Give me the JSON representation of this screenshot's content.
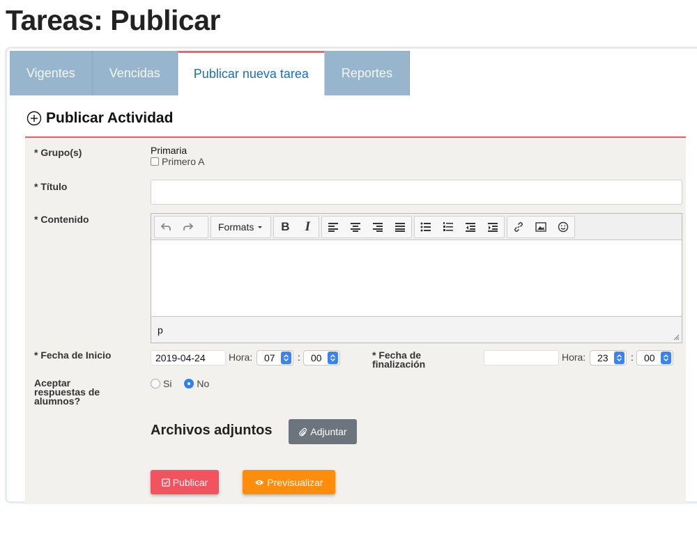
{
  "page": {
    "title": "Tareas: Publicar"
  },
  "tabs": [
    {
      "label": "Vigentes",
      "active": false
    },
    {
      "label": "Vencidas",
      "active": false
    },
    {
      "label": "Publicar nueva tarea",
      "active": true
    },
    {
      "label": "Reportes",
      "active": false
    }
  ],
  "section": {
    "title": "Publicar Actividad",
    "icon": "plus-circle-icon"
  },
  "form": {
    "groups_label": "* Grupo(s)",
    "group_name": "Primaria",
    "group_option": "Primero A",
    "group_option_checked": false,
    "title_label": "* Título",
    "title_value": "",
    "content_label": "* Contenido",
    "start_label": "* Fecha de Inicio",
    "start_date": "2019-04-24",
    "hora_label": "Hora:",
    "start_hour": "07",
    "start_min": "00",
    "colon": ":",
    "end_label_1": "* Fecha de",
    "end_label_2": "finalización",
    "end_date": "",
    "end_hour": "23",
    "end_min": "00",
    "accept_label_1": "Aceptar",
    "accept_label_2": "respuestas de",
    "accept_label_3": "alumnos?",
    "radio_yes": "Si",
    "radio_no": "No",
    "selected_radio": "No"
  },
  "editor": {
    "formats_label": "Formats",
    "status_path": "p",
    "toolbar_icons": [
      "undo-icon",
      "redo-icon",
      "bold-icon",
      "italic-icon",
      "align-left-icon",
      "align-center-icon",
      "align-right-icon",
      "align-justify-icon",
      "bullet-list-icon",
      "numbered-list-icon",
      "outdent-icon",
      "indent-icon",
      "link-icon",
      "image-icon",
      "emoticon-icon"
    ]
  },
  "attachments": {
    "title": "Archivos adjuntos",
    "button_label": "Adjuntar"
  },
  "actions": {
    "publish_label": "Publicar",
    "preview_label": "Previsualizar"
  },
  "colors": {
    "tab_bg": "#97b6cd",
    "accent_red": "#f4606c",
    "link_blue": "#1a6fb8",
    "publish": "#f2545f",
    "preview": "#ff8c0a",
    "attach": "#6c757d",
    "panel": "#f2f1ee"
  }
}
